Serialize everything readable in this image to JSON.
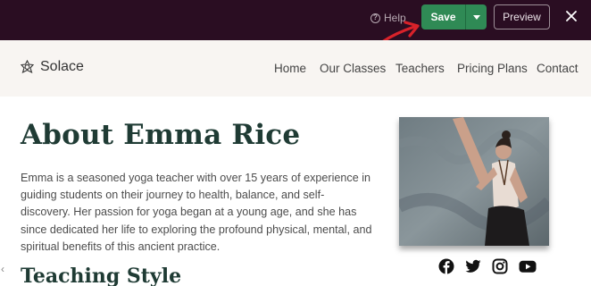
{
  "editor": {
    "help_label": "Help",
    "help_icon_glyph": "?",
    "save_label": "Save",
    "preview_label": "Preview",
    "colors": {
      "bar": "#2a0d22",
      "save": "#2f8a55",
      "arrow": "#d8222a"
    }
  },
  "site": {
    "logo_text": "Solace",
    "nav": [
      "Home",
      "Our Classes",
      "Teachers",
      "Pricing Plans",
      "Contact"
    ]
  },
  "page": {
    "title": "About Emma Rice",
    "bio_lines": [
      "Emma is a seasoned yoga teacher with over 15 years of experience in",
      "guiding students on their journey to health, balance, and self-",
      "discovery. Her passion for yoga began at a young age, and she has",
      "since dedicated her life to exploring the profound physical, mental, and",
      "spiritual benefits of this ancient practice."
    ],
    "section_title": "Teaching Style",
    "social_icons": [
      "facebook-icon",
      "twitter-icon",
      "instagram-icon",
      "youtube-icon"
    ]
  }
}
